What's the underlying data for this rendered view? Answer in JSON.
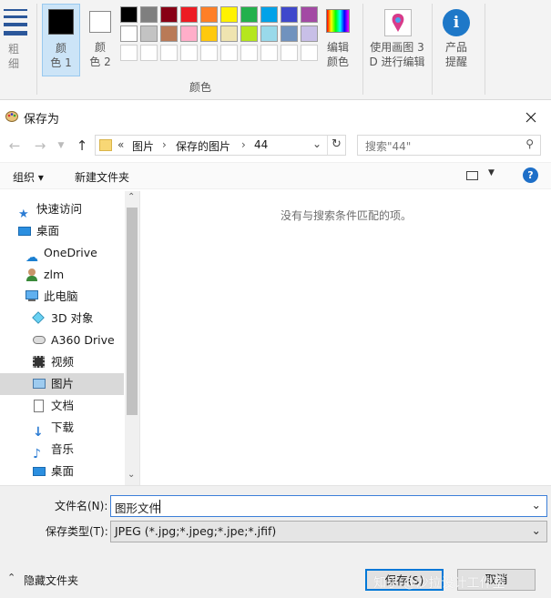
{
  "ribbon": {
    "size_label": "粗\n细",
    "color1_label": "颜\n色 1",
    "color2_label": "颜\n色 2",
    "colors_group_label": "颜色",
    "edit_colors_label": "编辑\n颜色",
    "paint3d_label": "使用画图 3\nD 进行编辑",
    "product_alert_label": "产品\n提醒",
    "color1_value": "#000000",
    "color2_value": "#ffffff",
    "palette_row1": [
      "#000000",
      "#7f7f7f",
      "#880015",
      "#ed1c24",
      "#ff7f27",
      "#fff200",
      "#22b14c",
      "#00a2e8",
      "#3f48cc",
      "#a349a4"
    ],
    "palette_row2": [
      "#ffffff",
      "#c3c3c3",
      "#b97a57",
      "#ffaec9",
      "#ffc90e",
      "#efe4b0",
      "#b5e61d",
      "#99d9ea",
      "#7092be",
      "#c8bfe7"
    ],
    "palette_row3": [
      "#ffffff",
      "#ffffff",
      "#ffffff",
      "#ffffff",
      "#ffffff",
      "#ffffff",
      "#ffffff",
      "#ffffff",
      "#ffffff",
      "#ffffff"
    ]
  },
  "dialog": {
    "title": "保存为",
    "breadcrumb_prefix": "«",
    "breadcrumb": [
      "图片",
      "保存的图片",
      "44"
    ],
    "search_placeholder": "搜索\"44\"",
    "organize_label": "组织 ▾",
    "new_folder_label": "新建文件夹",
    "empty_message": "没有与搜索条件匹配的项。",
    "nav_items": [
      {
        "label": "快速访问",
        "icon": "star-icon"
      },
      {
        "label": "桌面",
        "icon": "desktop-icon"
      },
      {
        "label": "OneDrive",
        "icon": "cloud-icon"
      },
      {
        "label": "zlm",
        "icon": "user-icon"
      },
      {
        "label": "此电脑",
        "icon": "computer-icon"
      },
      {
        "label": "3D 对象",
        "icon": "cube-icon"
      },
      {
        "label": "A360 Drive",
        "icon": "drive-icon"
      },
      {
        "label": "视频",
        "icon": "video-icon"
      },
      {
        "label": "图片",
        "icon": "pictures-icon"
      },
      {
        "label": "文档",
        "icon": "document-icon"
      },
      {
        "label": "下载",
        "icon": "download-icon"
      },
      {
        "label": "音乐",
        "icon": "music-icon"
      },
      {
        "label": "桌面",
        "icon": "desktop-icon"
      }
    ],
    "filename_label": "文件名(N):",
    "filename_value": "图形文件",
    "filetype_label": "保存类型(T):",
    "filetype_value": "JPEG (*.jpg;*.jpeg;*.jpe;*.jfif)",
    "hide_folders_label": "隐藏文件夹",
    "save_label": "保存(S)",
    "cancel_label": "取消",
    "watermark": "知乎 @沙拉设计工作室"
  }
}
